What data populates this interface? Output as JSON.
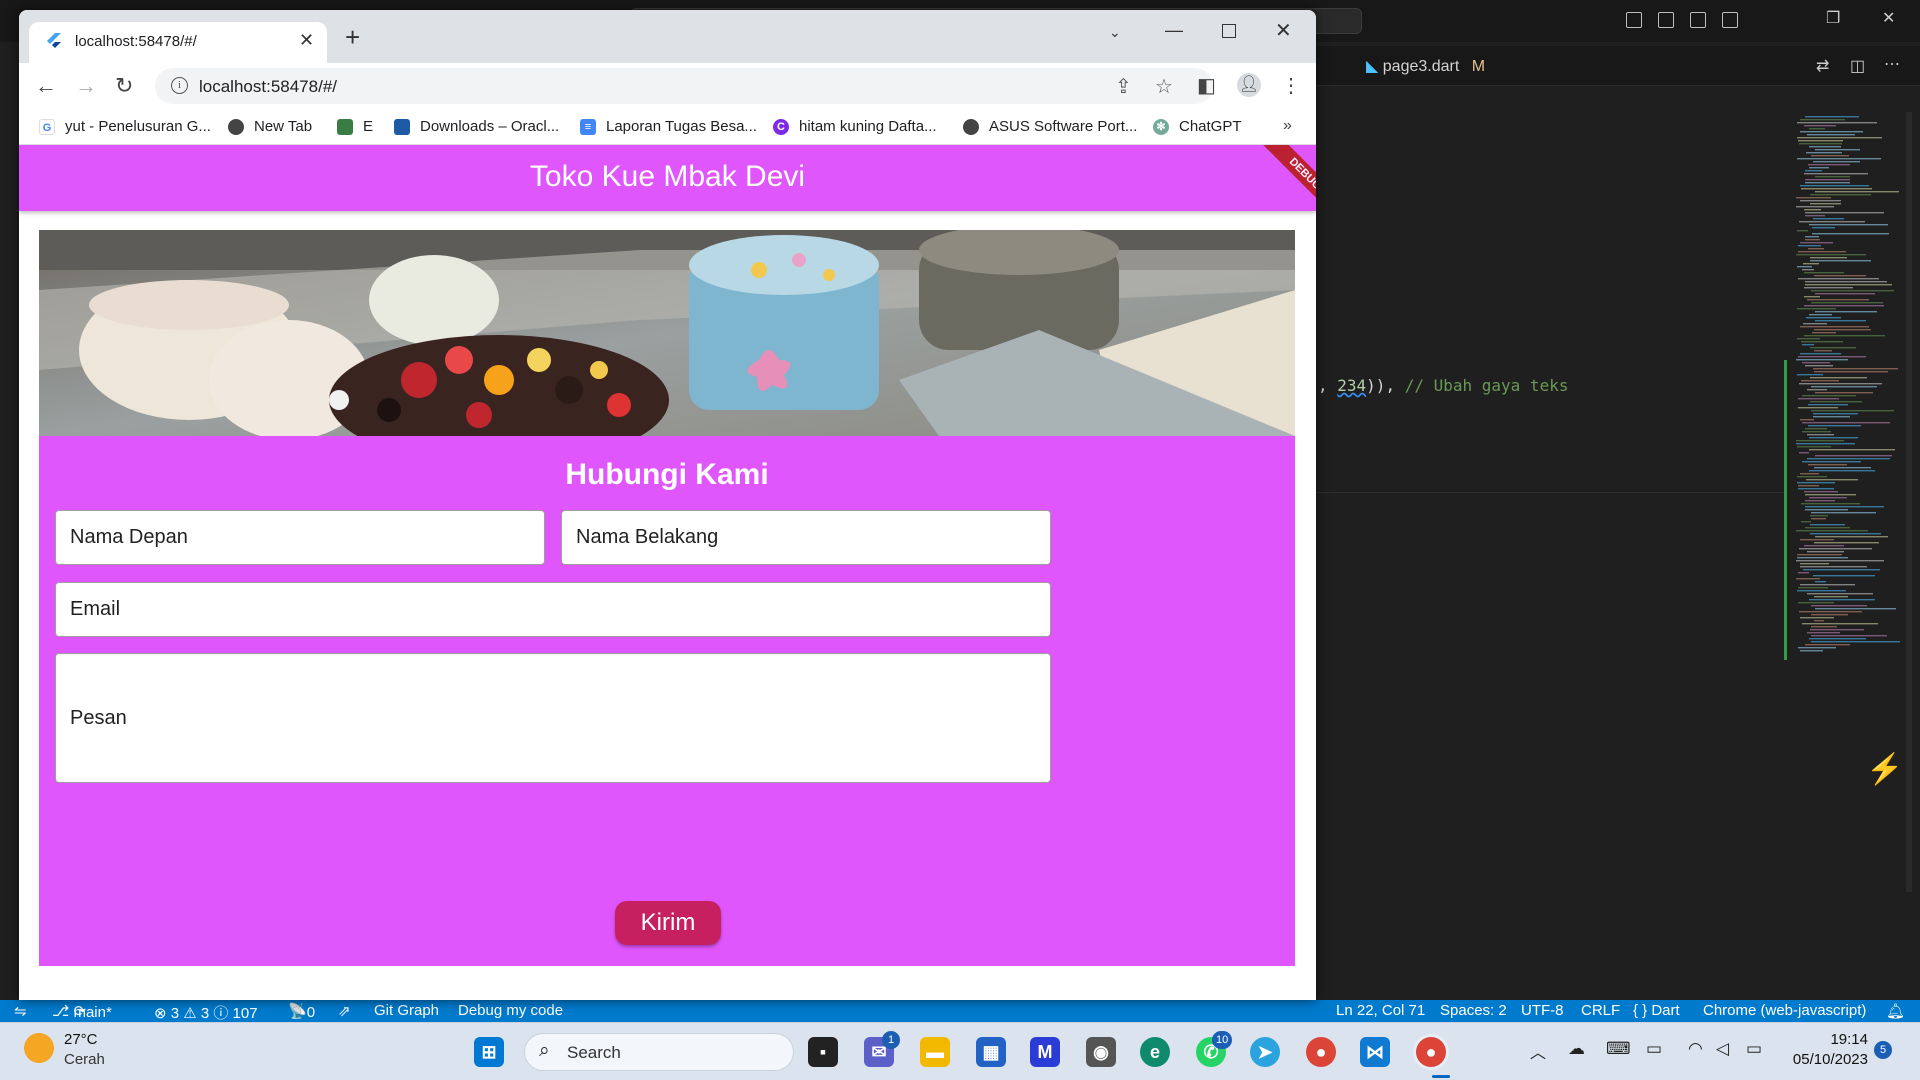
{
  "browser": {
    "tab_title": "localhost:58478/#/",
    "url": "localhost:58478/#/",
    "bookmarks": [
      {
        "label": "yut - Penelusuran G...",
        "icon": "google-icon",
        "color": "#4285f4"
      },
      {
        "label": "New Tab",
        "icon": "globe-icon",
        "color": "#444444"
      },
      {
        "label": "E",
        "icon": "robot-icon",
        "color": "#3a7d44"
      },
      {
        "label": "Downloads – Oracl...",
        "icon": "chart-icon",
        "color": "#1f5aa6"
      },
      {
        "label": "Laporan Tugas Besa...",
        "icon": "docs-icon",
        "color": "#4285f4"
      },
      {
        "label": "hitam kuning Dafta...",
        "icon": "canva-icon",
        "color": "#7d2ae8"
      },
      {
        "label": "ASUS Software Port...",
        "icon": "globe-icon",
        "color": "#444444"
      },
      {
        "label": "ChatGPT",
        "icon": "chatgpt-icon",
        "color": "#74aa9c"
      }
    ],
    "bookmarks_more": "»"
  },
  "app": {
    "title": "Toko Kue Mbak Devi",
    "debug_banner": "DEBUG",
    "form": {
      "heading": "Hubungi Kami",
      "first_name": "Nama Depan",
      "last_name": "Nama Belakang",
      "email": "Email",
      "message": "Pesan",
      "submit": "Kirim"
    },
    "colors": {
      "primary": "#e056fd",
      "button": "#c62060"
    }
  },
  "vscode": {
    "tab_file": "page3.dart",
    "tab_status": "M",
    "code_number": "234",
    "code_comment": "// Ubah gaya teks",
    "status": {
      "branch": "main*",
      "problems": "⊗ 3 ⚠ 3 ⓘ 107",
      "ports": "0",
      "git_graph": "Git Graph",
      "debug": "Debug my code",
      "position": "Ln 22, Col 71",
      "spaces": "Spaces: 2",
      "encoding": "UTF-8",
      "eol": "CRLF",
      "language": "{ } Dart",
      "target": "Chrome (web-javascript)"
    }
  },
  "taskbar": {
    "weather_temp": "27°C",
    "weather_desc": "Cerah",
    "search": "Search",
    "time": "19:14",
    "date": "05/10/2023",
    "notification_count": "5",
    "teams_badge": "1",
    "whatsapp_badge": "10"
  }
}
